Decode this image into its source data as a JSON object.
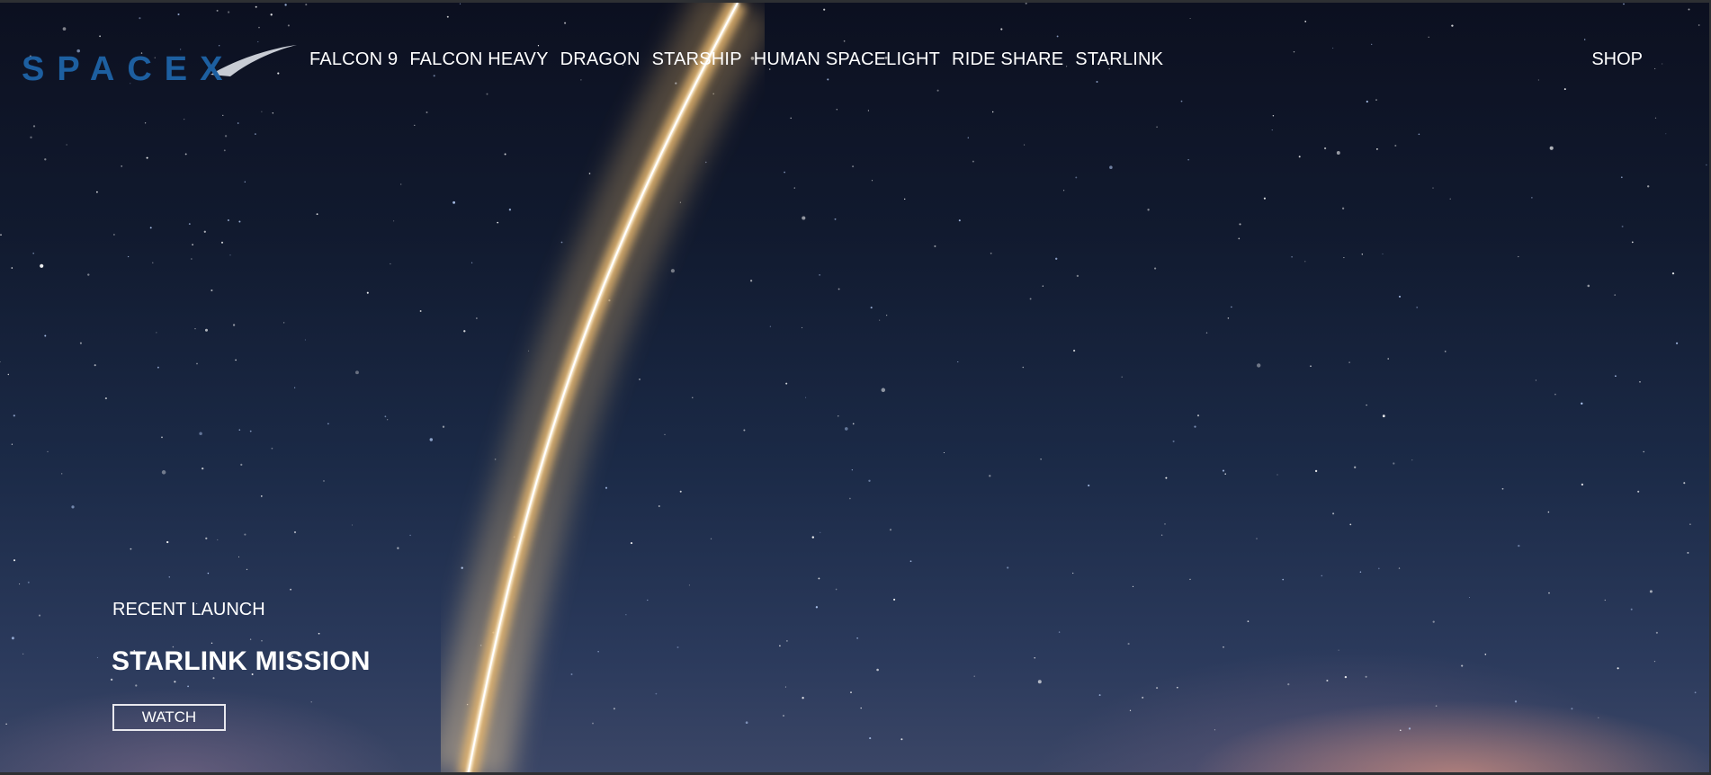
{
  "brand": {
    "logo_text": "SPACEX",
    "logo_color": "#1d5fa0",
    "swoosh_color": "#c8ccd4"
  },
  "nav": {
    "items": [
      {
        "label": "FALCON 9"
      },
      {
        "label": "FALCON HEAVY"
      },
      {
        "label": "DRAGON"
      },
      {
        "label": "STARSHIP"
      },
      {
        "label": "HUMAN SPACELIGHT"
      },
      {
        "label": "RIDE SHARE"
      },
      {
        "label": "STARLINK"
      }
    ],
    "shop_label": "SHOP"
  },
  "hero": {
    "eyebrow": "RECENT LAUNCH",
    "title": "STARLINK MISSION",
    "cta_label": "WATCH"
  },
  "colors": {
    "text": "#ffffff",
    "sky_top": "#0c1020",
    "sky_bottom": "#3b4666",
    "glow": "#d69280"
  }
}
